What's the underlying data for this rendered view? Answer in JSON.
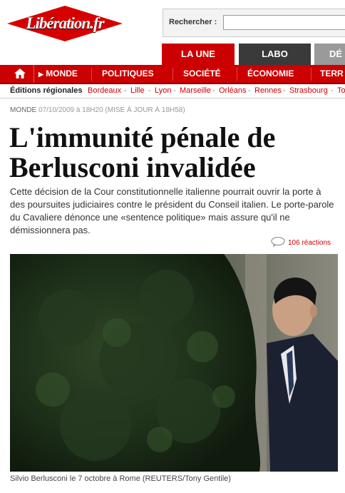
{
  "brand": {
    "name": "Libération.fr",
    "red": "#cc0000"
  },
  "search": {
    "label": "Rechercher :",
    "value": ""
  },
  "tabs": [
    {
      "label": "LA UNE",
      "active": true
    },
    {
      "label": "LABO",
      "active": false
    },
    {
      "label": "DÉ",
      "active": false
    }
  ],
  "nav": {
    "home_icon": "house-icon",
    "items": [
      "MONDE",
      "POLITIQUES",
      "SOCIÉTÉ",
      "ÉCONOMIE",
      "TERR"
    ]
  },
  "editions": {
    "label": "Éditions régionales",
    "cities": [
      "Bordeaux",
      "Lille",
      "Lyon",
      "Marseille",
      "Orléans",
      "Rennes",
      "Strasbourg",
      "To"
    ]
  },
  "article": {
    "section": "MONDE",
    "date": "07/10/2009 à 18H20 (MISE À JOUR À 18H58)",
    "title": "L'immunité pénale de Berlusconi invalidée",
    "lede": "Cette décision de la Cour constitutionnelle italienne pourrait ouvrir la porte à des poursuites judiciaires contre le président du Conseil italien. Le porte-parole du Cavaliere dénonce une «sentence politique» mais assure qu'il ne démissionnera pas.",
    "reactions": "106 réactions",
    "caption": "Silvio Berlusconi le 7 octobre à Rome (REUTERS/Tony Gentile)"
  }
}
